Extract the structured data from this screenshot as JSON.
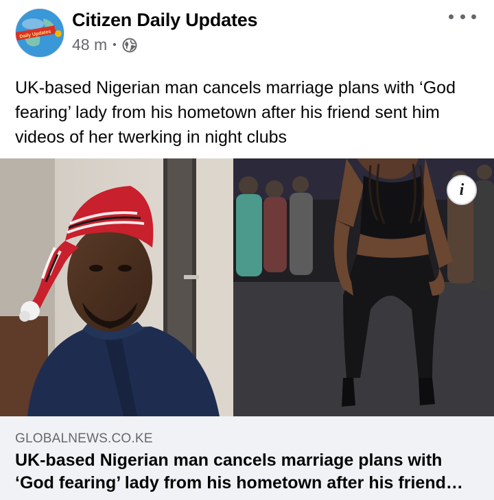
{
  "post": {
    "page_name": "Citizen Daily Updates",
    "time_ago": "48 m",
    "separator": "•",
    "audience_icon": "globe-icon",
    "more_icon": "more-options-icon",
    "text": "UK-based Nigerian man cancels marriage plans with ‘God fearing’ lady from his hometown after his friend sent him videos of her twerking in night clubs"
  },
  "avatar": {
    "logo_text": "Daily Updates",
    "colors": {
      "globe": "#3a97d8",
      "banner": "#d93025"
    }
  },
  "media": {
    "left_photo": "man-in-red-striped-cap-selfie",
    "right_photo": "woman-dancing-in-club",
    "info_icon": "info-icon",
    "info_label": "i"
  },
  "link_preview": {
    "domain": "GLOBALNEWS.CO.KE",
    "title": "UK-based Nigerian man cancels marriage plans with ‘God fearing’ lady from his hometown after his friend sent him videos of her twerking in night clubs"
  },
  "colors": {
    "text_primary": "#050505",
    "text_secondary": "#65676b",
    "preview_background": "#f0f2f5"
  }
}
